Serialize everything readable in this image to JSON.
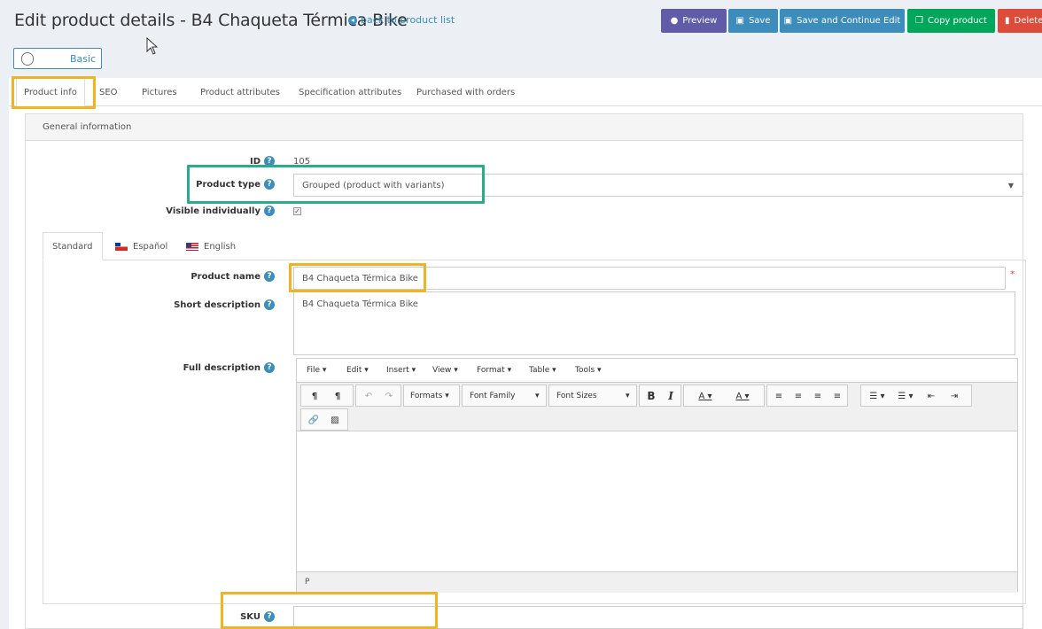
{
  "header": {
    "title": "Edit product details - B4 Chaqueta Térmica Bike",
    "back_link": "back to product list",
    "buttons": {
      "preview": "Preview",
      "save": "Save",
      "save_continue": "Save and Continue Edit",
      "copy": "Copy product",
      "delete": "Delete"
    },
    "mode_toggle": "Basic"
  },
  "tabs": [
    {
      "label": "Product info"
    },
    {
      "label": "SEO"
    },
    {
      "label": "Pictures"
    },
    {
      "label": "Product attributes"
    },
    {
      "label": "Specification attributes"
    },
    {
      "label": "Purchased with orders"
    }
  ],
  "panel": {
    "heading": "General information",
    "id_label": "ID",
    "id_value": "105",
    "product_type_label": "Product type",
    "product_type_value": "Grouped (product with variants)",
    "visible_label": "Visible individually",
    "visible_checked": true
  },
  "lang_tabs": [
    {
      "label": "Standard"
    },
    {
      "label": "Español"
    },
    {
      "label": "English"
    }
  ],
  "product_form": {
    "name_label": "Product name",
    "name_value": "B4 Chaqueta Térmica Bike",
    "short_desc_label": "Short description",
    "short_desc_value": "B4 Chaqueta Térmica Bike",
    "full_desc_label": "Full description",
    "sku_label": "SKU",
    "sku_value": ""
  },
  "editor": {
    "menu": [
      "File ▾",
      "Edit ▾",
      "Insert ▾",
      "View ▾",
      "Format ▾",
      "Table ▾",
      "Tools ▾"
    ],
    "formats": "Formats",
    "font_family": "Font Family",
    "font_sizes": "Font Sizes",
    "status_path": "P"
  },
  "colors": {
    "accent": "#3c8dbc",
    "preview": "#605ca8",
    "copy": "#00a65a",
    "delete": "#dd4b39",
    "highlight_orange": "#f0b323",
    "highlight_green": "#2bab8a"
  }
}
